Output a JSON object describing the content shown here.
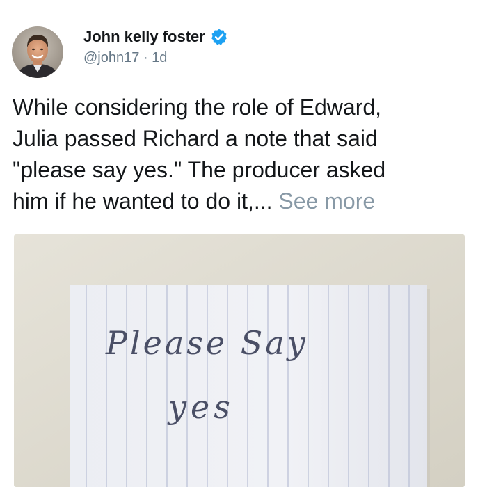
{
  "author": {
    "name": "John kelly foster",
    "handle": "@john17",
    "separator": "·",
    "time": "1d"
  },
  "post": {
    "lines": [
      "While considering the role of Edward,",
      "Julia passed Richard a note that said",
      "\"please say yes.\" The producer asked",
      "him if he wanted to do it,..."
    ],
    "see_more": "See more"
  },
  "photo": {
    "note_line1": "Please Say",
    "note_line2": "yes"
  },
  "colors": {
    "verified": "#1da1f2",
    "link_muted": "#8899a6",
    "text": "#14171a",
    "meta": "#657786"
  },
  "icons": {
    "verified": "verified-badge-icon"
  }
}
